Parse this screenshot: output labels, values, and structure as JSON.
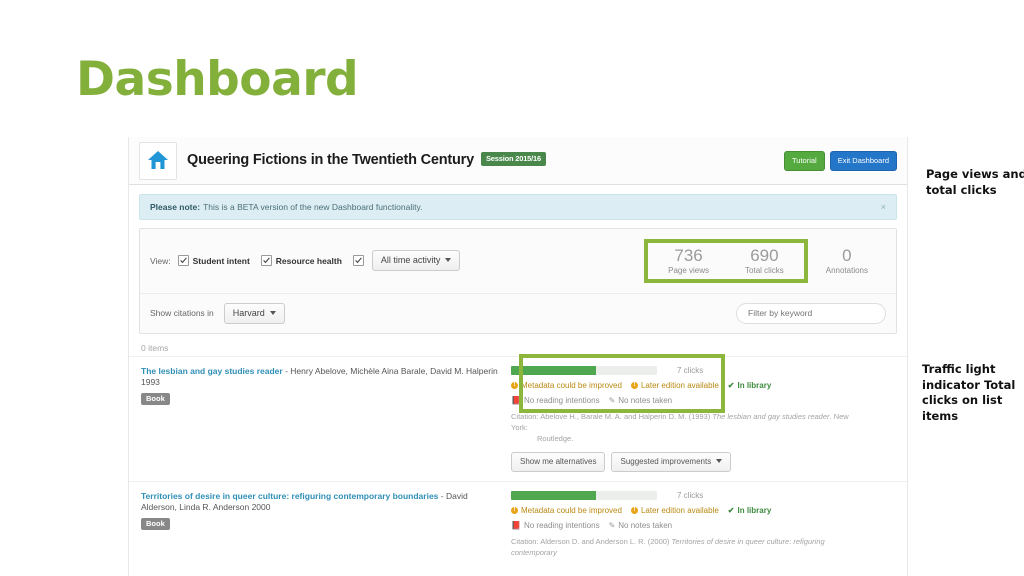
{
  "slide": {
    "title": "Dashboard",
    "title_color": "#83af3b"
  },
  "app": {
    "header": {
      "home_icon": "home-icon",
      "title": "Queering Fictions in the Twentieth Century",
      "session_badge": "Session 2015/16",
      "tutorial_button": "Tutorial",
      "exit_button": "Exit Dashboard",
      "tutorial_color": "#54a93f",
      "exit_color": "#2476c8"
    },
    "notice": {
      "lead": "Please note:",
      "text": "This is a BETA version of the new Dashboard functionality.",
      "close": "×"
    },
    "view_bar": {
      "label": "View:",
      "checkboxes": [
        {
          "label": "Student intent",
          "checked": true
        },
        {
          "label": "Resource health",
          "checked": true
        },
        {
          "label": "",
          "checked": true
        }
      ],
      "time_filter": "All time activity"
    },
    "stats": {
      "highlight_color": "#8cb63c",
      "items": [
        {
          "value": "736",
          "label": "Page views",
          "highlighted": true
        },
        {
          "value": "690",
          "label": "Total clicks",
          "highlighted": true
        },
        {
          "value": "0",
          "label": "Annotations",
          "highlighted": false
        }
      ]
    },
    "citation_bar": {
      "label": "Show citations in",
      "style": "Harvard",
      "filter_placeholder": "Filter by keyword"
    },
    "list": {
      "items_count": "0 items",
      "items": [
        {
          "title": "The lesbian and gay studies reader",
          "meta": " - Henry Abelove, Michèle Aina Barale, David M. Halperin 1993",
          "type_badge": "Book",
          "clicks_text": "7 clicks",
          "bar_percent": 58,
          "bar_color": "#4fa84f",
          "flags": [
            {
              "text": "Metadata could be improved",
              "kind": "warn"
            },
            {
              "text": "Later edition available",
              "kind": "warn"
            },
            {
              "text": "In library",
              "kind": "ok"
            }
          ],
          "sub_flags": [
            {
              "text": "No reading intentions",
              "icon": "book-icon"
            },
            {
              "text": "No notes taken",
              "icon": "pencil-icon"
            }
          ],
          "citation_label": "Citation:",
          "citation_part1": "Abelove H., Barale M. A. and Halperin D. M. (1993) ",
          "citation_italic": "The lesbian and gay studies reader",
          "citation_part2": ". New York:",
          "citation_part3": "Routledge.",
          "actions": [
            "Show me alternatives",
            "Suggested improvements"
          ]
        },
        {
          "title": "Territories of desire in queer culture: refiguring contemporary boundaries",
          "meta": " - David Alderson, Linda R. Anderson 2000",
          "type_badge": "Book",
          "clicks_text": "7 clicks",
          "bar_percent": 58,
          "bar_color": "#4fa84f",
          "flags": [
            {
              "text": "Metadata could be improved",
              "kind": "warn"
            },
            {
              "text": "Later edition available",
              "kind": "warn"
            },
            {
              "text": "In library",
              "kind": "ok"
            }
          ],
          "sub_flags": [
            {
              "text": "No reading intentions",
              "icon": "book-icon"
            },
            {
              "text": "No notes taken",
              "icon": "pencil-icon"
            }
          ],
          "citation_label": "Citation:",
          "citation_part1": "Alderson D. and Anderson L. R. (2000) ",
          "citation_italic": "Territories of desire in queer culture: refiguring contemporary",
          "citation_part2": "",
          "citation_part3": "",
          "actions": []
        }
      ]
    }
  },
  "annotations": [
    {
      "text": "Page views and total clicks"
    },
    {
      "text": "Traffic light indicator Total clicks on list items"
    }
  ]
}
